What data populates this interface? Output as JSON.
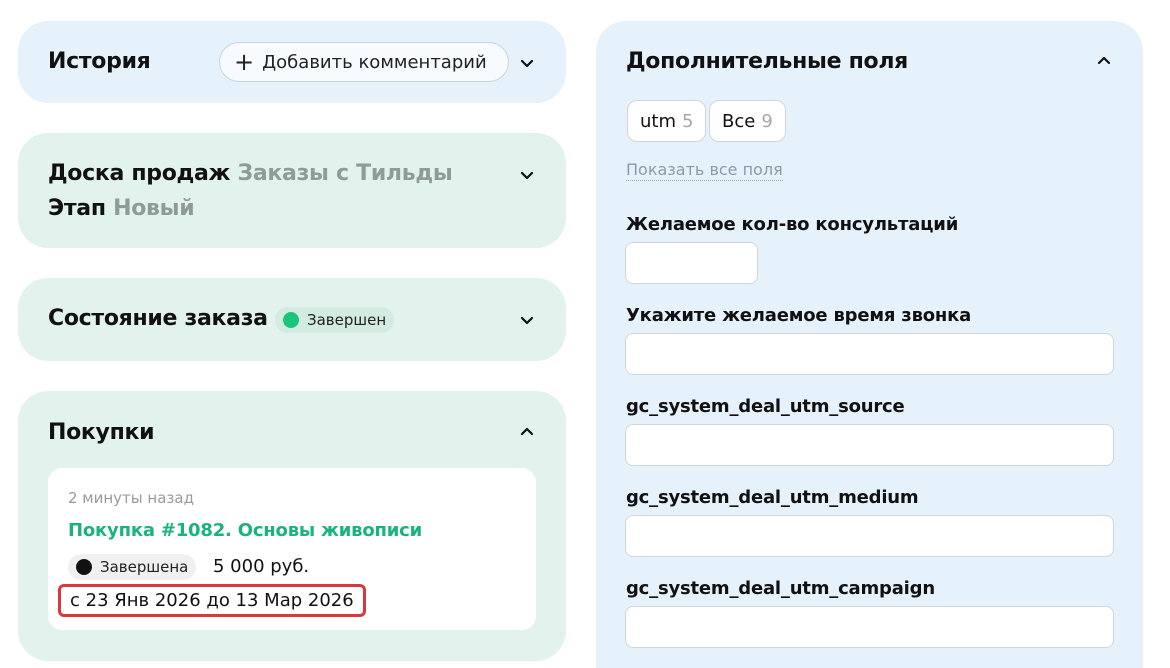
{
  "history": {
    "title": "История",
    "add_comment_label": "Добавить комментарий"
  },
  "sales_board": {
    "label": "Доска продаж",
    "value": "Заказы с Тильды",
    "stage_label": "Этап",
    "stage_value": "Новый"
  },
  "order_status": {
    "title": "Состояние заказа",
    "status": "Завершен",
    "status_color": "#1bc47d"
  },
  "purchases": {
    "title": "Покупки",
    "item": {
      "time": "2 минуты назад",
      "title": "Покупка #1082. Основы живописи",
      "status": "Завершена",
      "status_color": "#111111",
      "price": "5 000 руб.",
      "date_range": "с 23 Янв 2026 до 13 Мар 2026"
    }
  },
  "extra_fields": {
    "title": "Дополнительные поля",
    "tags": [
      {
        "label": "utm",
        "count": "5"
      },
      {
        "label": "Все",
        "count": "9"
      }
    ],
    "show_all": "Показать все поля",
    "fields": [
      {
        "label": "Желаемое кол-во консультаций",
        "value": ""
      },
      {
        "label": "Укажите желаемое время звонка",
        "value": ""
      },
      {
        "label": "gc_system_deal_utm_source",
        "value": ""
      },
      {
        "label": "gc_system_deal_utm_medium",
        "value": ""
      },
      {
        "label": "gc_system_deal_utm_campaign",
        "value": ""
      }
    ]
  },
  "colors": {
    "accent_green": "#1cb27c",
    "highlight_red": "#d9393c"
  }
}
